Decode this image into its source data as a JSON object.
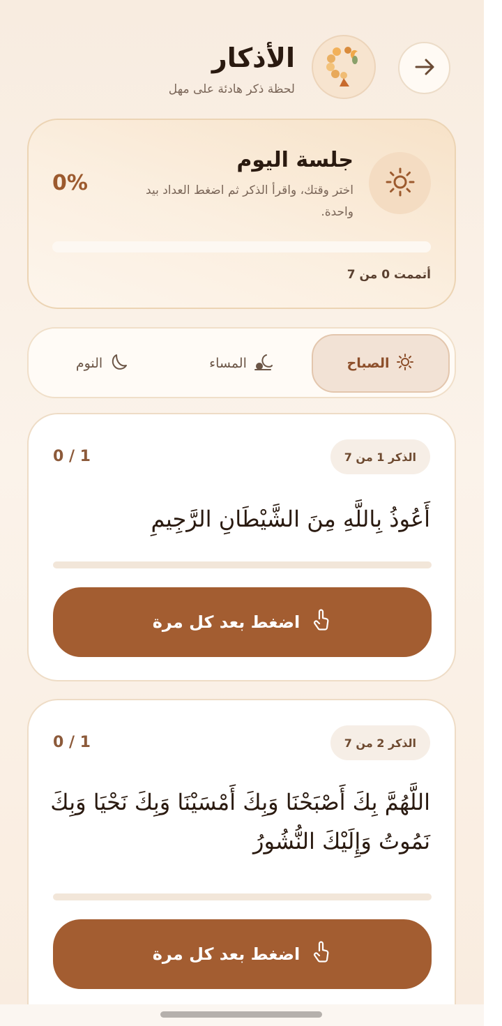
{
  "header": {
    "title": "الأذكار",
    "subtitle": "لحظة ذكر هادئة على مهل",
    "back_icon": "arrow-right-icon",
    "logo_icon": "prayer-beads-icon"
  },
  "session": {
    "title": "جلسة اليوم",
    "description": "اختر وقتك، واقرأ الذكر ثم اضغط العداد بيد واحدة.",
    "percent_label": "0%",
    "progress": 0,
    "completed_label": "أتممت 0 من 7",
    "icon": "sun-icon"
  },
  "tabs": [
    {
      "label": "الصباح",
      "icon": "sun-icon",
      "active": true
    },
    {
      "label": "المساء",
      "icon": "sunset-icon",
      "active": false
    },
    {
      "label": "النوم",
      "icon": "moon-icon",
      "active": false
    }
  ],
  "dhikr": [
    {
      "index_label": "الذكر 1 من 7",
      "counter": "0 / 1",
      "progress": 0,
      "text": "أَعُوذُ بِاللَّهِ مِنَ الشَّيْطَانِ الرَّجِيمِ",
      "button_label": "اضغط بعد كل مرة"
    },
    {
      "index_label": "الذكر 2 من 7",
      "counter": "0 / 1",
      "progress": 0,
      "text": "اللَّهُمَّ بِكَ أَصْبَحْنَا وَبِكَ أَمْسَيْنَا وَبِكَ نَحْيَا وَبِكَ نَمُوتُ وَإِلَيْكَ النُّشُورُ",
      "button_label": "اضغط بعد كل مرة"
    }
  ],
  "colors": {
    "accent": "#a35d31",
    "percent": "#9c5a2e",
    "card_border": "#eedcc6"
  }
}
